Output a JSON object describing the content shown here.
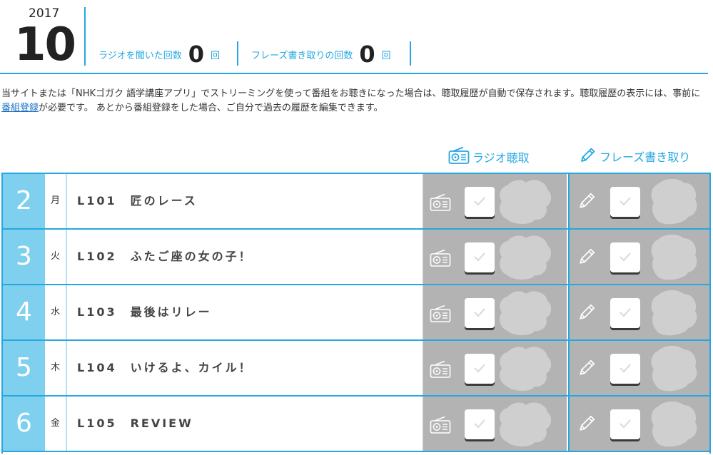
{
  "header": {
    "year": "2017",
    "month": "10",
    "radio_count_label": "ラジオを聞いた回数",
    "radio_count": "0",
    "radio_count_unit": "回",
    "phrase_count_label": "フレーズ書き取りの回数",
    "phrase_count": "0",
    "phrase_count_unit": "回"
  },
  "notice": {
    "text_before": "当サイトまたは「NHKゴガク 語学講座アプリ」でストリーミングを使って番組をお聴きになった場合は、聴取履歴が自動で保存されます。聴取履歴の表示には、事前に",
    "link": "番組登録",
    "text_after": "が必要です。 あとから番組登録をした場合、ご自分で過去の履歴を編集できます。"
  },
  "columns": {
    "radio": "ラジオ聴取",
    "phrase": "フレーズ書き取り"
  },
  "rows": [
    {
      "day": "2",
      "weekday": "月",
      "title": "L101　匠のレース"
    },
    {
      "day": "3",
      "weekday": "火",
      "title": "L102　ふたご座の女の子！"
    },
    {
      "day": "4",
      "weekday": "水",
      "title": "L103　最後はリレー"
    },
    {
      "day": "5",
      "weekday": "木",
      "title": "L104　いけるよ、カイル！"
    },
    {
      "day": "6",
      "weekday": "金",
      "title": "L105　REVIEW"
    }
  ],
  "colors": {
    "accent": "#25a8e0",
    "day_cell": "#7fd0ef",
    "status_zone": "#b3b3b3"
  },
  "icons": {
    "radio": "radio-icon",
    "pencil": "pencil-icon",
    "check": "check-icon",
    "mascot": "mascot-silhouette"
  }
}
